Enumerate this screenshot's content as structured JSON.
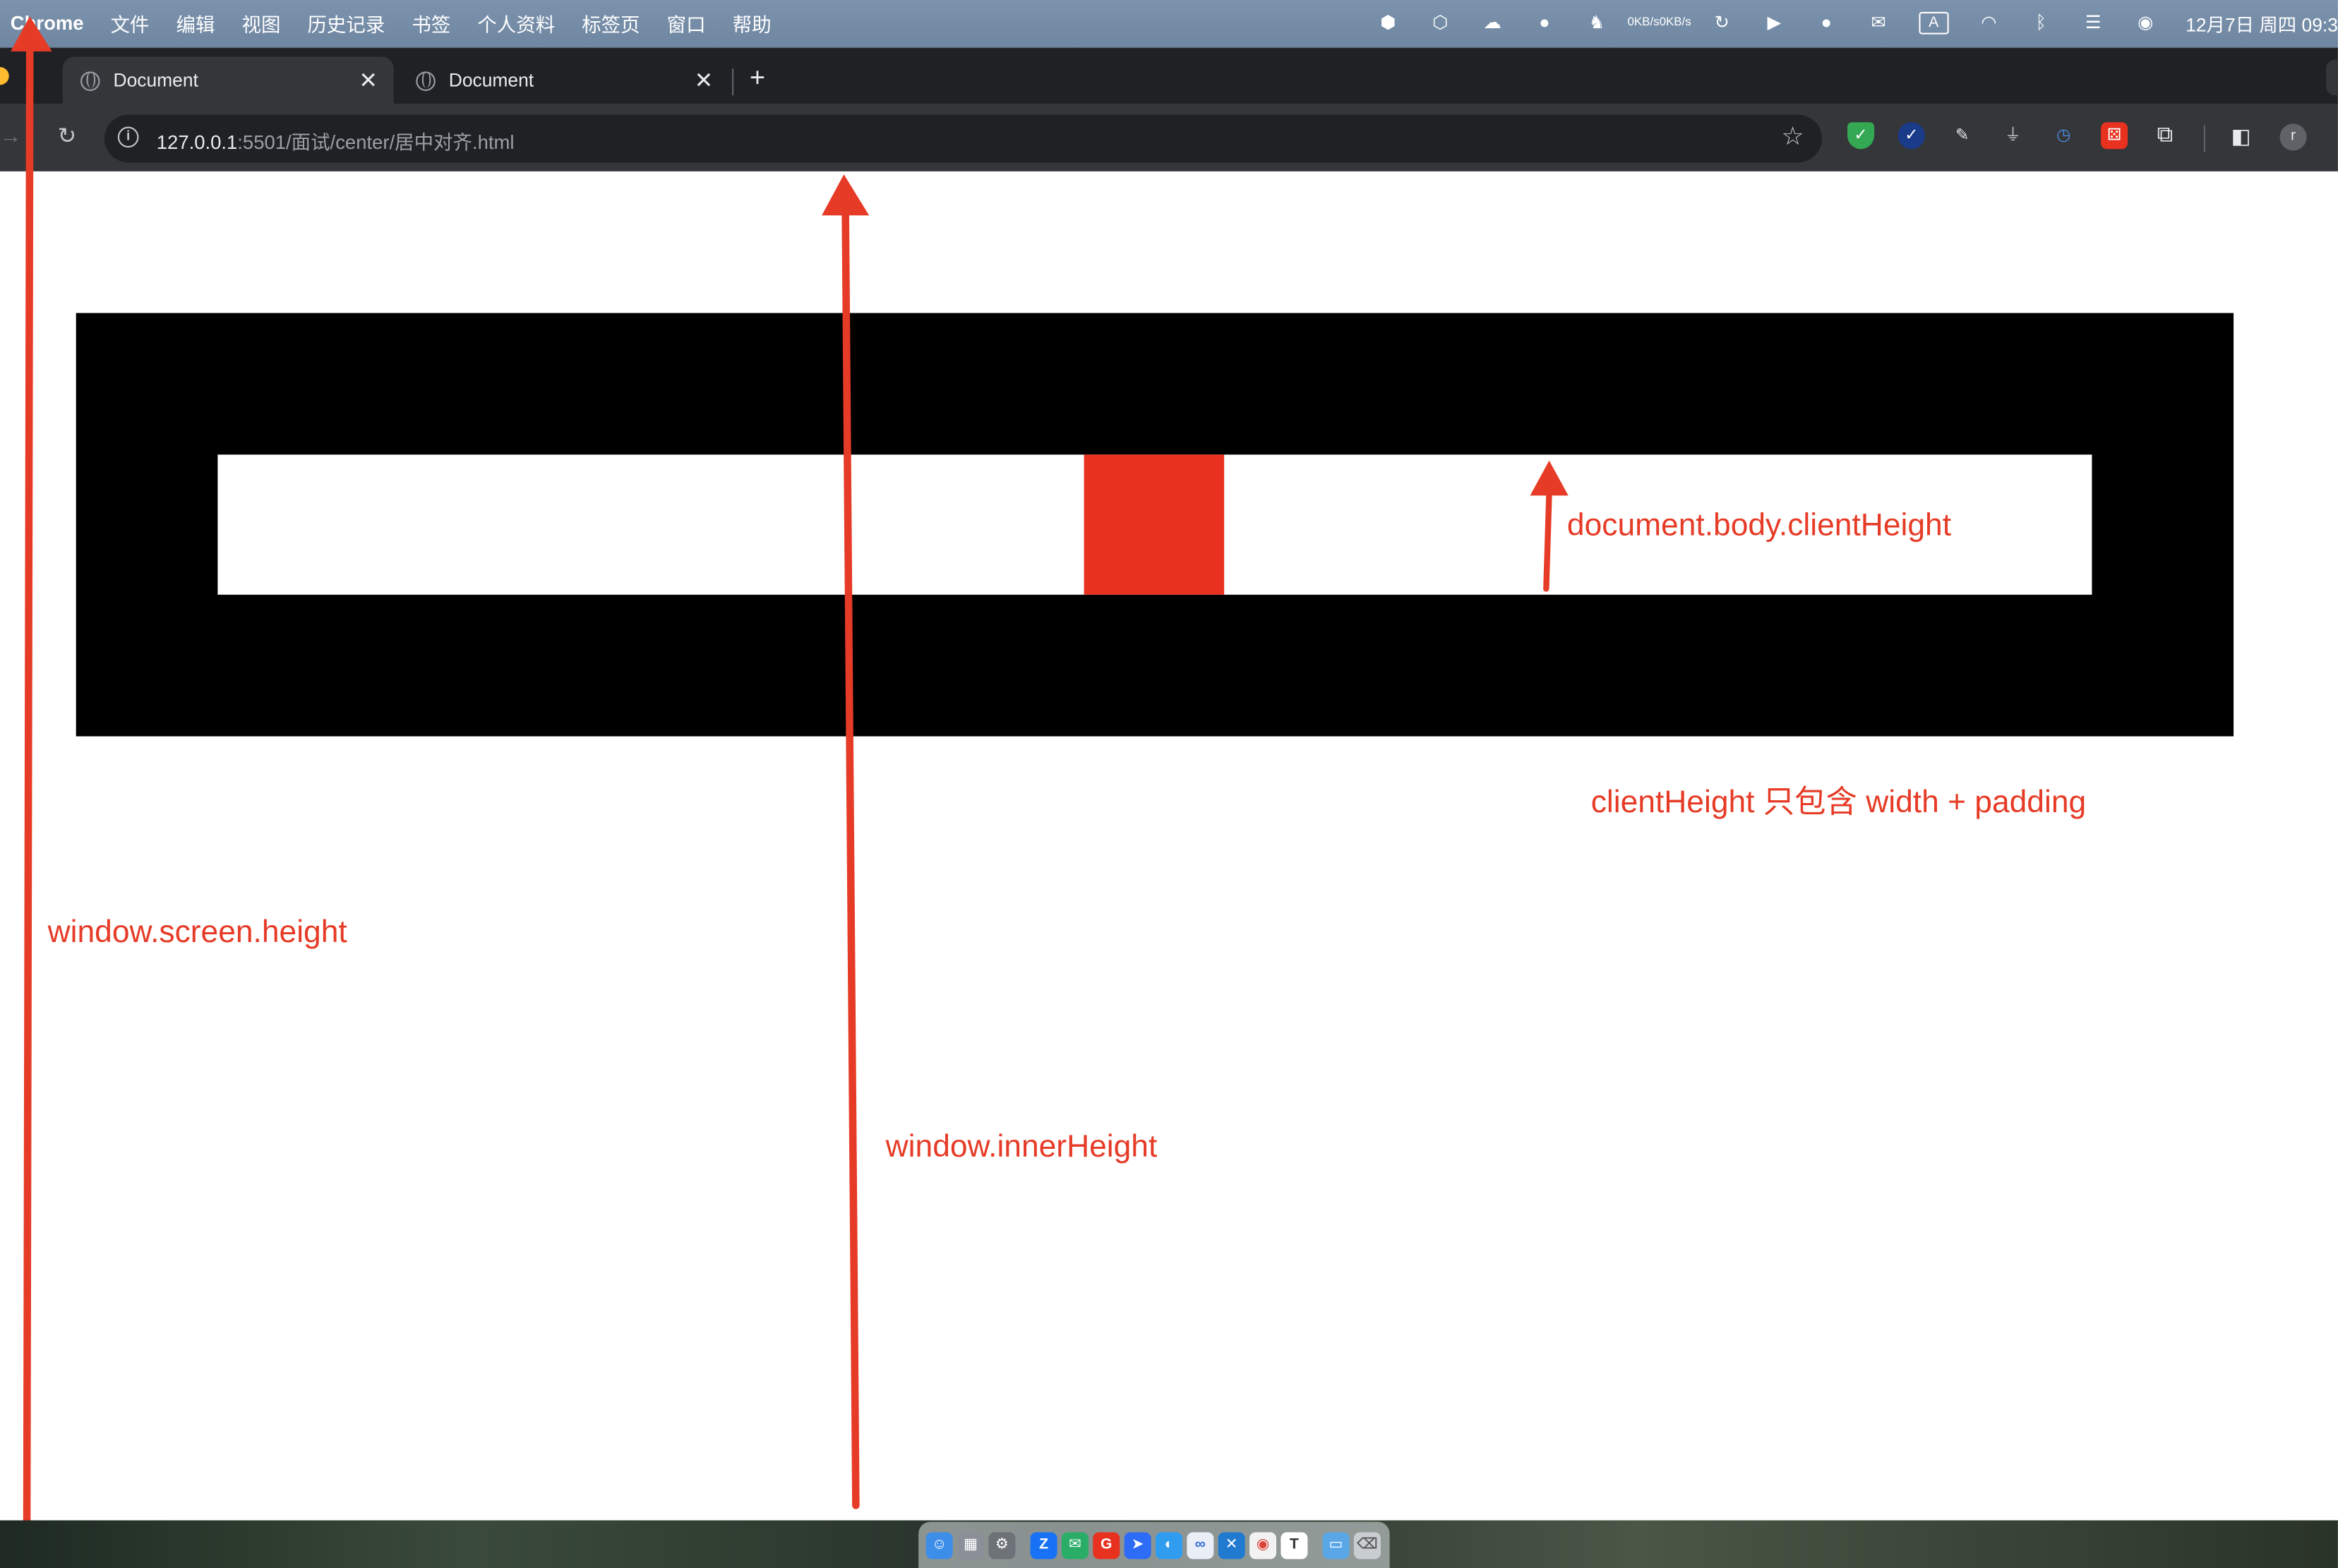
{
  "menubar": {
    "app_name": "Chrome",
    "items": [
      "文件",
      "编辑",
      "视图",
      "历史记录",
      "书签",
      "个人资料",
      "标签页",
      "窗口",
      "帮助"
    ],
    "net_up": "0KB/s",
    "net_down": "0KB/s",
    "input_method": "A",
    "clock": "12月7日 周四 09:3"
  },
  "tabs": [
    {
      "title": "Document",
      "active": true
    },
    {
      "title": "Document",
      "active": false
    }
  ],
  "new_tab_label": "+",
  "toolbar": {
    "url_host": "127.0.0.1",
    "url_path": ":5501/面试/center/居中对齐.html",
    "avatar_letter": "r"
  },
  "page": {
    "colors": {
      "outer": "#000000",
      "inner": "#ffffff",
      "square": "#e8311f",
      "annotation": "#e63b26"
    }
  },
  "annotations": {
    "body_client_height": "document.body.clientHeight",
    "client_height_note": "clientHeight 只包含 width + padding",
    "screen_height": "window.screen.height",
    "inner_height": "window.innerHeight"
  },
  "dock": {
    "apps": [
      "finder-icon",
      "launchpad-icon",
      "settings-icon",
      "zhihu-icon",
      "wechat-icon",
      "git-icon",
      "feishu-icon",
      "browser-icon",
      "baidu-icon",
      "vscode-icon",
      "chrome-icon",
      "typora-icon",
      "folder-icon",
      "trash-icon"
    ]
  }
}
